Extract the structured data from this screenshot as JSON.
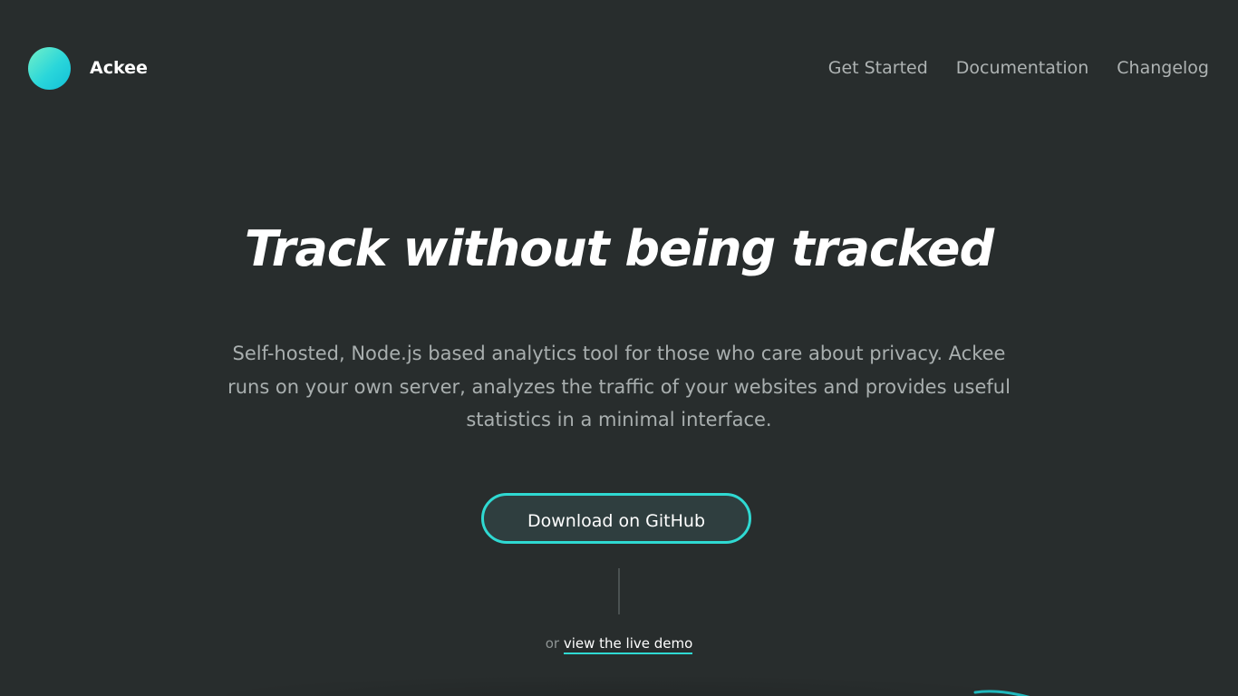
{
  "header": {
    "brand": "Ackee",
    "nav": [
      {
        "label": "Get Started"
      },
      {
        "label": "Documentation"
      },
      {
        "label": "Changelog"
      }
    ]
  },
  "hero": {
    "title": "Track without being tracked",
    "subtitle_lines": [
      "Self-hosted, Node.js based analytics tool for those who care about privacy. Ackee",
      "runs on your own server, analyzes the traffic of your websites and provides useful",
      "statistics in a minimal interface."
    ],
    "cta_label": "Download on GitHub",
    "demo_prefix": "or",
    "demo_link": "view the live demo"
  },
  "colors": {
    "background": "#282d2d",
    "accent": "#2fd9d2",
    "logo_gradient_start": "#73f0c8",
    "logo_gradient_end": "#12c0d8"
  },
  "icons": {
    "logo": "logo-circle-icon"
  }
}
